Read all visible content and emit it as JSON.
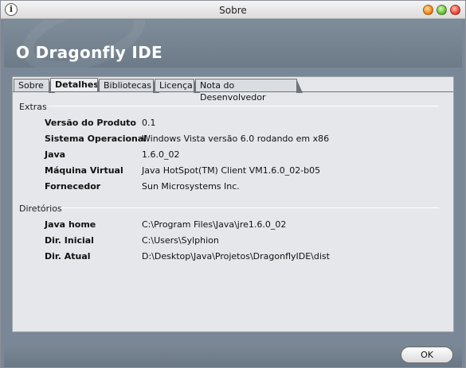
{
  "window": {
    "title": "Sobre"
  },
  "header": {
    "title": "O Dragonfly IDE"
  },
  "tabs": [
    {
      "label": "Sobre"
    },
    {
      "label": "Detalhes"
    },
    {
      "label": "Bibliotecas"
    },
    {
      "label": "Licença"
    },
    {
      "label": "Nota do Desenvolvedor"
    }
  ],
  "active_tab": "Detalhes",
  "extras": {
    "section_label": "Extras",
    "rows": [
      {
        "label": "Versão do Produto",
        "value": "0.1"
      },
      {
        "label": "Sistema Operacional",
        "value": "Windows Vista versão 6.0 rodando em x86"
      },
      {
        "label": "Java",
        "value": "1.6.0_02"
      },
      {
        "label": "Máquina Virtual",
        "value": "Java HotSpot(TM) Client VM1.6.0_02-b05"
      },
      {
        "label": "Fornecedor",
        "value": "Sun Microsystems Inc."
      }
    ]
  },
  "directories": {
    "section_label": "Diretórios",
    "rows": [
      {
        "label": "Java home",
        "value": "C:\\Program Files\\Java\\jre1.6.0_02"
      },
      {
        "label": "Dir. Inicial",
        "value": "C:\\Users\\Sylphion"
      },
      {
        "label": "Dir. Atual",
        "value": "D:\\Desktop\\Java\\Projetos\\DragonflyIDE\\dist"
      }
    ]
  },
  "footer": {
    "ok_label": "OK"
  },
  "icons": {
    "info": "info-icon",
    "minimize": "minimize-icon",
    "maximize": "maximize-icon",
    "close": "close-icon"
  }
}
